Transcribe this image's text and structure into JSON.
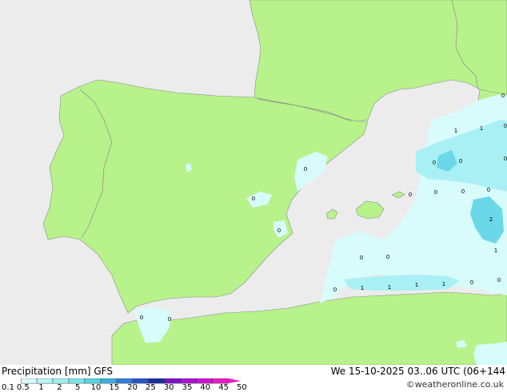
{
  "footer": {
    "left_label": "Precipitation [mm]  GFS",
    "right_label": "We 15-10-2025 03..06 UTC (06+144",
    "credit": "©weatheronline.co.uk"
  },
  "legend": {
    "ticks": [
      "0.1",
      "0.5",
      "1",
      "2",
      "5",
      "10",
      "15",
      "20",
      "25",
      "30",
      "35",
      "40",
      "45",
      "50"
    ],
    "colors": [
      "#d8fbfb",
      "#b9f6f6",
      "#a0f0f0",
      "#7ae6ec",
      "#56d4e4",
      "#3aaee0",
      "#2e7fd8",
      "#2656c8",
      "#1c2ca0",
      "#7a12c8",
      "#a814d4",
      "#d010d8",
      "#e81cc8"
    ]
  },
  "colors": {
    "land": "#b8f28a",
    "sea": "#ececec",
    "border": "#8c8c8c",
    "precip_light": "#d8fbfb",
    "precip_mid": "#a8f0f4",
    "precip_strong": "#6ad8e8"
  },
  "map_values": [
    {
      "id": "v1",
      "text": "0"
    },
    {
      "id": "v2",
      "text": "0"
    },
    {
      "id": "v3",
      "text": "0"
    },
    {
      "id": "v4",
      "text": "0"
    },
    {
      "id": "v5",
      "text": "0"
    },
    {
      "id": "v6",
      "text": "1"
    },
    {
      "id": "v7",
      "text": "1"
    },
    {
      "id": "v8",
      "text": "0"
    },
    {
      "id": "v9",
      "text": "0"
    },
    {
      "id": "v10",
      "text": "0"
    },
    {
      "id": "v11",
      "text": "0"
    },
    {
      "id": "v12",
      "text": "0"
    },
    {
      "id": "v13",
      "text": "0"
    },
    {
      "id": "v14",
      "text": "0"
    },
    {
      "id": "v15",
      "text": "2"
    },
    {
      "id": "v16",
      "text": "1"
    },
    {
      "id": "v17",
      "text": "0"
    },
    {
      "id": "v18",
      "text": "0"
    },
    {
      "id": "v19",
      "text": "0"
    },
    {
      "id": "v20",
      "text": "1"
    },
    {
      "id": "v21",
      "text": "1"
    },
    {
      "id": "v22",
      "text": "1"
    },
    {
      "id": "v23",
      "text": "1"
    },
    {
      "id": "v24",
      "text": "0"
    },
    {
      "id": "v25",
      "text": "0"
    },
    {
      "id": "v26",
      "text": "0"
    },
    {
      "id": "v27",
      "text": "0"
    }
  ]
}
